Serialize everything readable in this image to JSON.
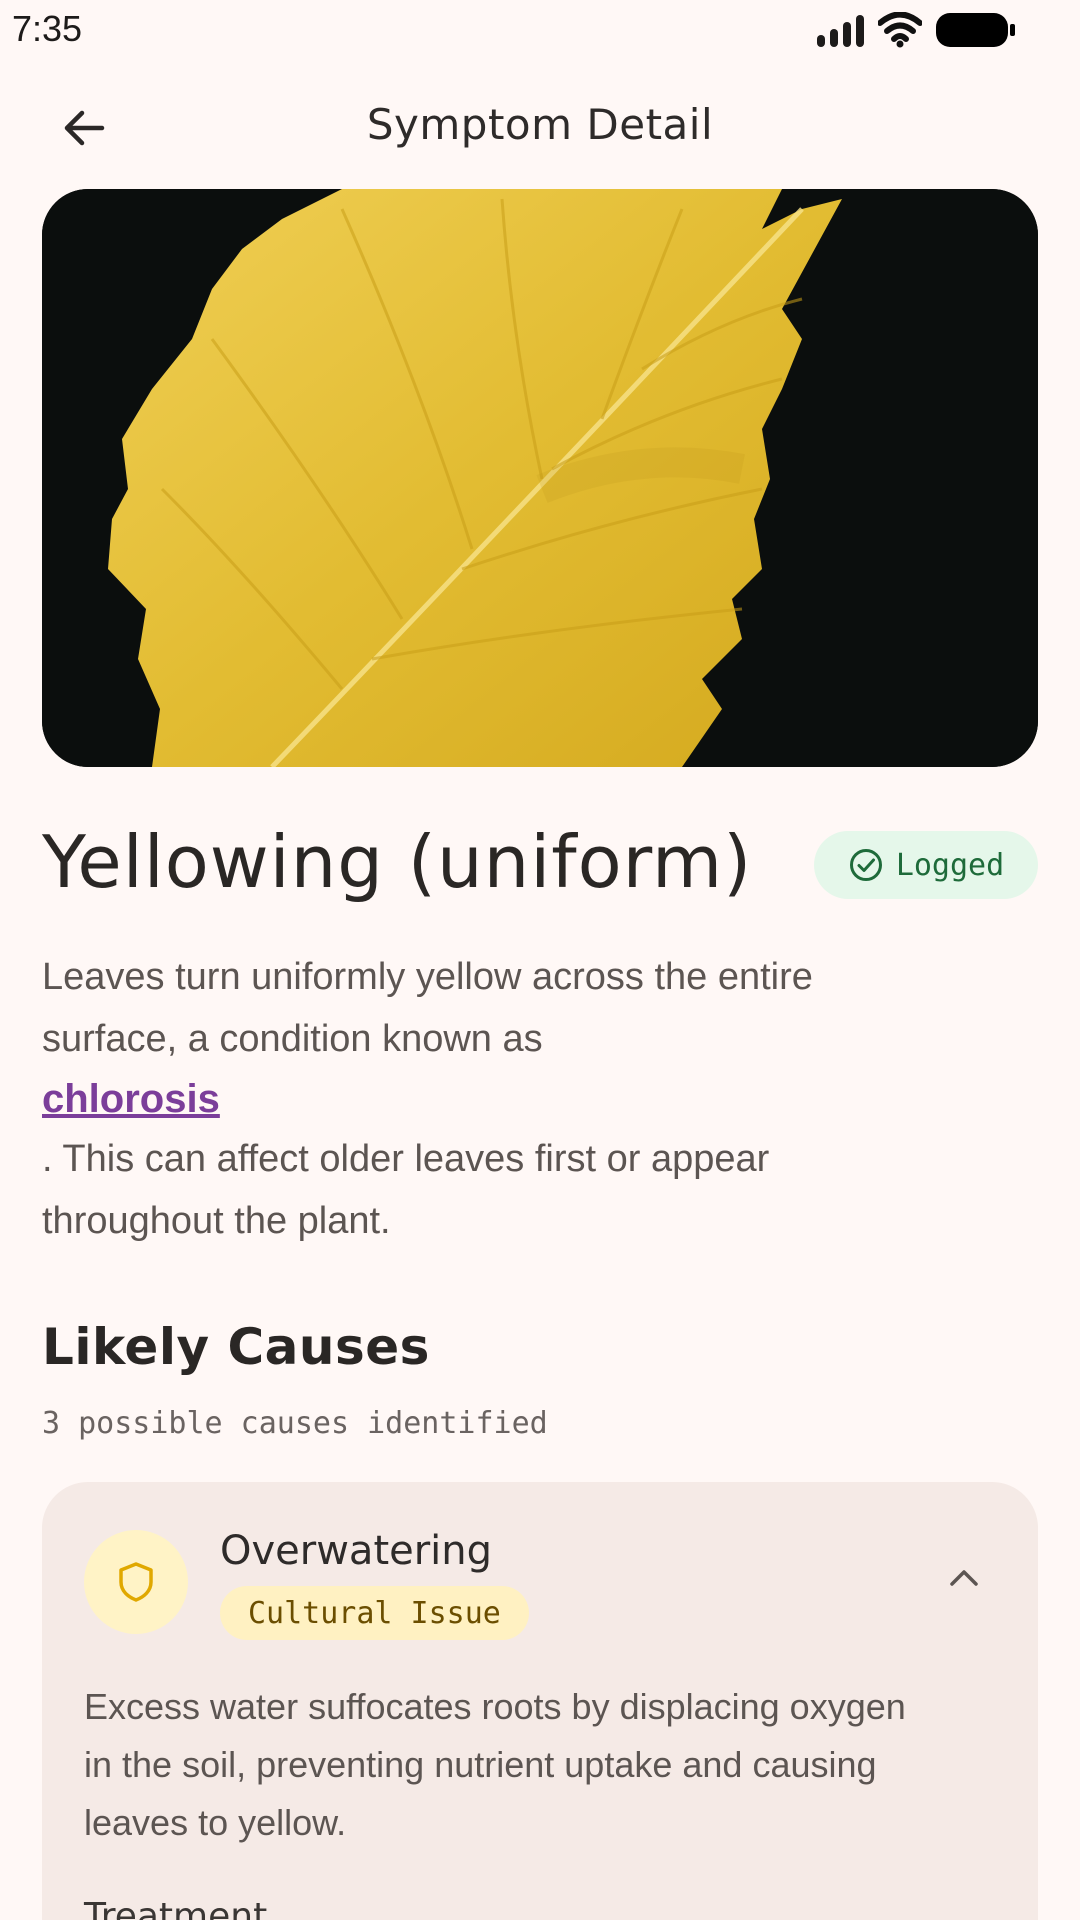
{
  "status_bar": {
    "time": "7:35",
    "icons": [
      "signal-icon",
      "wifi-icon",
      "battery-icon"
    ]
  },
  "app_bar": {
    "title": "Symptom Detail",
    "back_icon": "arrow-back-icon"
  },
  "hero": {
    "image": "yellow-leaf-photo",
    "colors": {
      "background": "#0B0E0D",
      "leaf": "#E9C43A"
    }
  },
  "symptom": {
    "title": "Yellowing (uniform)",
    "status_chip": {
      "label": "Logged",
      "icon": "check-circle-icon",
      "color": "#1E6B3A",
      "background": "#E5F7EA"
    },
    "description_lines": [
      "Leaves turn uniformly yellow across the entire",
      "surface, a condition known as"
    ],
    "link_text": "chlorosis",
    "description_after_lines": [
      ". This can affect older leaves first or appear",
      "throughout the plant."
    ]
  },
  "likely_causes": {
    "title": "Likely Causes",
    "subtitle": "3 possible causes identified",
    "items": [
      {
        "name": "Overwatering",
        "tag": "Cultural Issue",
        "icon": "shield-icon",
        "expand_icon": "chevron-up-icon",
        "description_lines": [
          "Excess water suffocates roots by displacing oxygen",
          "in the soil, preventing nutrient uptake and causing",
          "leaves to yellow."
        ],
        "treatment_label": "Treatment"
      }
    ]
  },
  "colors": {
    "background": "#FFF8F6",
    "card": "#F5EAE6",
    "link": "#7B3E9A",
    "tag_bg": "#FFF1C2",
    "tag_text": "#6B4E00",
    "icon_bg": "#FFF3C6",
    "icon_accent": "#E0A800"
  }
}
